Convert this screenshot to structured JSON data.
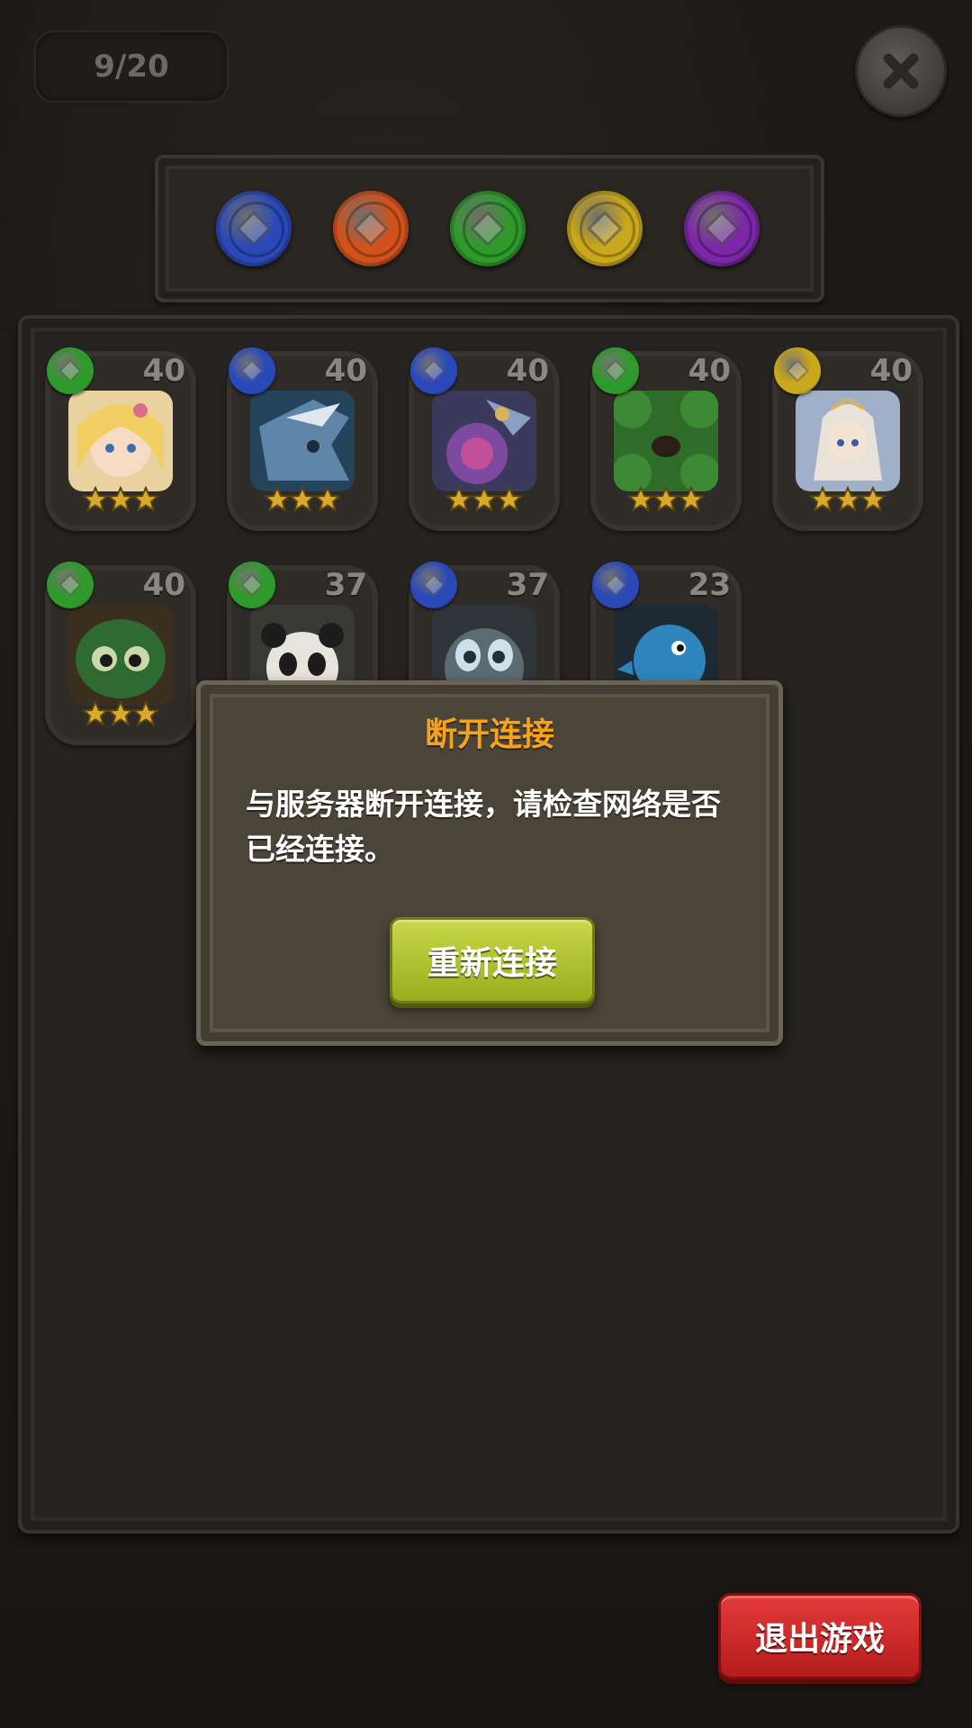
{
  "header": {
    "counter": "9/20"
  },
  "colors": {
    "blue": "#2a49b8",
    "red": "#d2521c",
    "green": "#2f9a2c",
    "yellow": "#c9a81c",
    "purple": "#7b27a8"
  },
  "filters": [
    {
      "name": "blue-orb-icon",
      "color": "#2a49b8"
    },
    {
      "name": "red-orb-icon",
      "color": "#d2521c"
    },
    {
      "name": "green-orb-icon",
      "color": "#2f9a2c"
    },
    {
      "name": "yellow-orb-icon",
      "color": "#c9a81c"
    },
    {
      "name": "purple-orb-icon",
      "color": "#7b27a8"
    }
  ],
  "cards": [
    {
      "level": "40",
      "attr": "#2f9a2c",
      "stars": 3,
      "icon": "fairy-girl-portrait-icon"
    },
    {
      "level": "40",
      "attr": "#2a49b8",
      "stars": 3,
      "icon": "blue-dragon-portrait-icon"
    },
    {
      "level": "40",
      "attr": "#2a49b8",
      "stars": 3,
      "icon": "purple-creature-portrait-icon"
    },
    {
      "level": "40",
      "attr": "#2f9a2c",
      "stars": 3,
      "icon": "green-shell-portrait-icon"
    },
    {
      "level": "40",
      "attr": "#c9a81c",
      "stars": 3,
      "icon": "angel-girl-portrait-icon"
    },
    {
      "level": "40",
      "attr": "#2f9a2c",
      "stars": 3,
      "icon": "green-beetle-portrait-icon"
    },
    {
      "level": "37",
      "attr": "#2f9a2c",
      "stars": 0,
      "icon": "panda-portrait-icon"
    },
    {
      "level": "37",
      "attr": "#2a49b8",
      "stars": 0,
      "icon": "grey-cat-portrait-icon"
    },
    {
      "level": "23",
      "attr": "#2a49b8",
      "stars": 0,
      "icon": "blue-bird-portrait-icon"
    }
  ],
  "dialog": {
    "title": "断开连接",
    "message": "与服务器断开连接，请检查网络是否已经连接。",
    "button": "重新连接"
  },
  "exit_button": "退出游戏"
}
